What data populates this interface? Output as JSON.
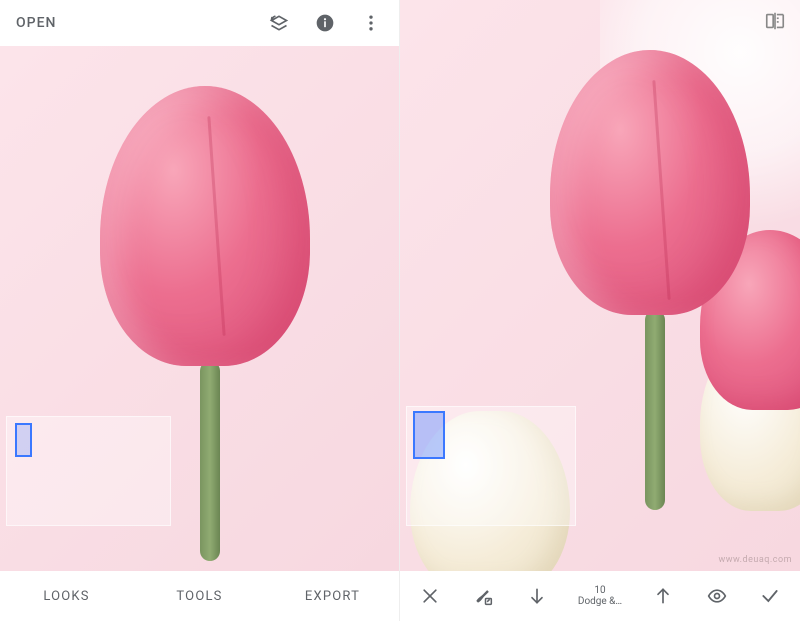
{
  "left": {
    "topbar": {
      "open_label": "OPEN"
    },
    "bottom_tabs": [
      "LOOKS",
      "TOOLS",
      "EXPORT"
    ]
  },
  "right": {
    "edit_bar": {
      "effect_value": "10",
      "effect_label": "Dodge &…"
    }
  },
  "watermark": "www.deuaq.com"
}
